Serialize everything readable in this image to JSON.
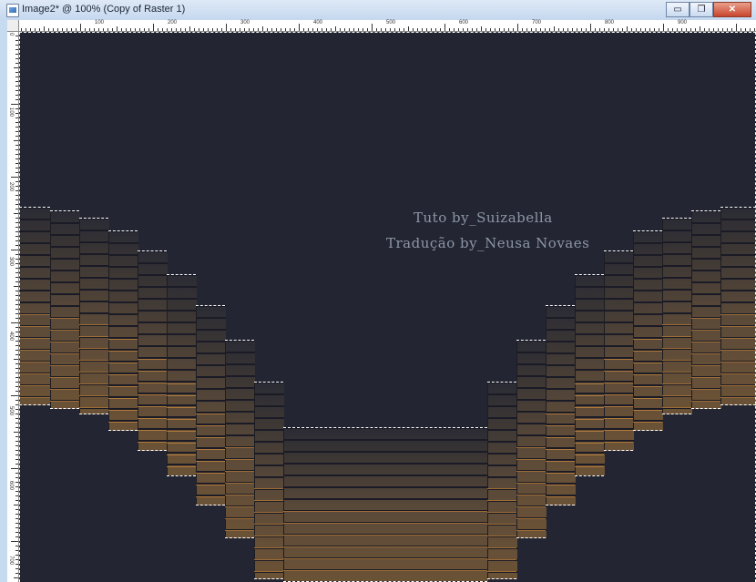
{
  "window": {
    "title": "Image2* @ 100% (Copy of Raster 1)",
    "controls": {
      "minimize": "▭",
      "restore": "❐",
      "close": "✕"
    }
  },
  "ruler": {
    "top_labels": [
      "100",
      "200",
      "300",
      "400",
      "500",
      "600",
      "700",
      "800",
      "900"
    ],
    "left_labels": [
      "0",
      "100",
      "200",
      "300",
      "400",
      "500",
      "600",
      "700"
    ]
  },
  "canvas": {
    "background": "#232632",
    "watermark": [
      "Tuto by_Suizabella",
      "Tradução by_Neusa Novaes"
    ]
  },
  "colors": {
    "selection": "#ffffff",
    "stripe_dark": "#1a1b26",
    "brown_top": "#3a3534",
    "brown_mid": "#5b4a39",
    "brown_bottom": "#6b5236",
    "accent_orange": "#c98a3d"
  }
}
